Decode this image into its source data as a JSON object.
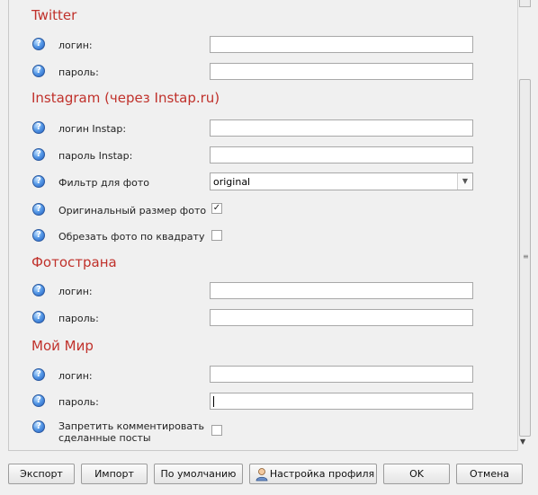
{
  "sections": {
    "twitter": {
      "title": "Twitter",
      "fields": [
        {
          "label": "логин:",
          "value": ""
        },
        {
          "label": "пароль:",
          "value": ""
        }
      ]
    },
    "instagram": {
      "title": "Instagram (через Instap.ru)",
      "fields": [
        {
          "label": "логин Instap:",
          "value": ""
        },
        {
          "label": "пароль Instap:",
          "value": ""
        }
      ],
      "filter": {
        "label": "Фильтр для фото",
        "value": "original"
      },
      "original_size": {
        "label": "Оригинальный размер фото",
        "checked": true
      },
      "crop_square": {
        "label": "Обрезать фото по квадрату",
        "checked": false
      }
    },
    "fotostrana": {
      "title": "Фотострана",
      "fields": [
        {
          "label": "логин:",
          "value": ""
        },
        {
          "label": "пароль:",
          "value": ""
        }
      ]
    },
    "moimir": {
      "title": "Мой Мир",
      "fields": [
        {
          "label": "логин:",
          "value": ""
        },
        {
          "label": "пароль:",
          "value": ""
        }
      ],
      "no_comments": {
        "label_line1": "Запретить комментировать",
        "label_line2": "сделанные посты",
        "checked": false
      }
    }
  },
  "help_icon_glyph": "?",
  "icons": {
    "help": "question-circle-icon",
    "user": "user-profile-icon",
    "dropdown": "chevron-down-icon"
  },
  "buttons": {
    "export": "Экспорт",
    "import": "Импорт",
    "defaults": "По умолчанию",
    "profile_settings": "Настройка профиля",
    "ok": "OK",
    "cancel": "Отмена"
  },
  "colors": {
    "section_title": "#c0312b",
    "help_icon": "#3b7bd6"
  }
}
